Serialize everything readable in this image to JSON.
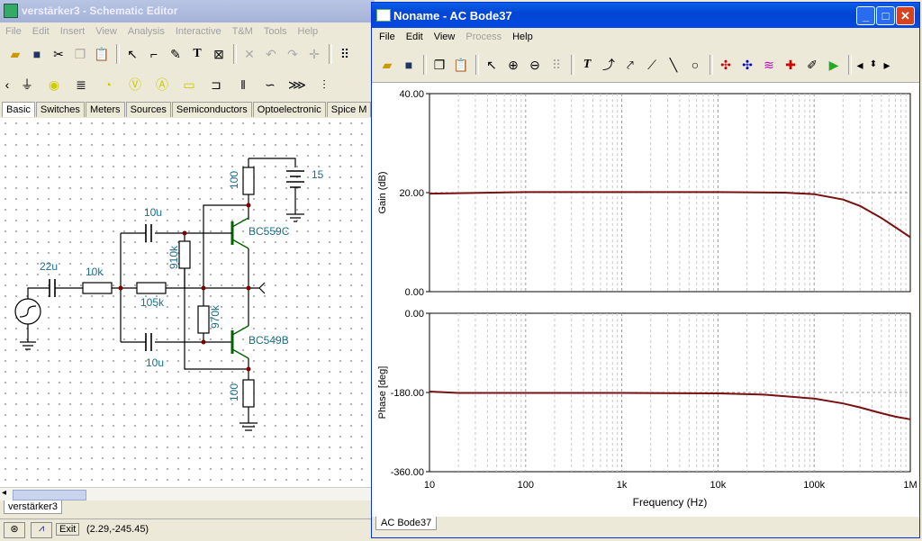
{
  "schematic": {
    "title": "verstärker3 - Schematic Editor",
    "menu": [
      "File",
      "Edit",
      "Insert",
      "View",
      "Analysis",
      "Interactive",
      "T&M",
      "Tools",
      "Help"
    ],
    "tabs": [
      "Basic",
      "Switches",
      "Meters",
      "Sources",
      "Semiconductors",
      "Optoelectronic",
      "Spice M"
    ],
    "sheet_tab": "verstärker3",
    "exit_label": "Exit",
    "coords": "(2.29,-245.45)",
    "labels": {
      "r_top": "100",
      "battery": "15",
      "c1": "10u",
      "q1": "BC559C",
      "r_910": "910k",
      "c_in": "22u",
      "r_10k": "10k",
      "r_105k": "105k",
      "r_970": "970k",
      "q2": "BC549B",
      "c2": "10u",
      "r_bot": "100"
    }
  },
  "bode": {
    "title": "Noname - AC Bode37",
    "menu": [
      "File",
      "Edit",
      "View",
      "Process",
      "Help"
    ],
    "bottom_tab": "AC Bode37",
    "gain_ylabel": "Gain (dB)",
    "phase_ylabel": "Phase [deg]",
    "xlabel": "Frequency (Hz)",
    "gain_ticks": [
      "40.00",
      "20.00",
      "0.00"
    ],
    "phase_ticks": [
      "0.00",
      "-180.00",
      "-360.00"
    ],
    "x_ticks": [
      "10",
      "100",
      "1k",
      "10k",
      "100k",
      "1M"
    ],
    "curve_color": "#7a1010"
  },
  "chart_data": [
    {
      "type": "line",
      "title": "",
      "xlabel": "Frequency (Hz)",
      "ylabel": "Gain (dB)",
      "xscale": "log",
      "xlim": [
        10,
        1000000
      ],
      "ylim": [
        0,
        40
      ],
      "grid": true,
      "series": [
        {
          "x": [
            10,
            100,
            1000,
            10000,
            50000,
            100000,
            200000,
            300000,
            500000,
            700000,
            1000000
          ],
          "y": [
            19.8,
            20.1,
            20.1,
            20.1,
            20.0,
            19.7,
            18.6,
            17.3,
            14.9,
            13.0,
            11.0
          ]
        }
      ]
    },
    {
      "type": "line",
      "title": "",
      "xlabel": "Frequency (Hz)",
      "ylabel": "Phase [deg]",
      "xscale": "log",
      "xlim": [
        10,
        1000000
      ],
      "ylim": [
        -360,
        0
      ],
      "grid": true,
      "series": [
        {
          "x": [
            10,
            20,
            100,
            1000,
            10000,
            30000,
            100000,
            200000,
            300000,
            500000,
            700000,
            1000000
          ],
          "y": [
            -178,
            -181,
            -181,
            -181,
            -182,
            -185,
            -194,
            -205,
            -214,
            -227,
            -235,
            -241
          ]
        }
      ]
    }
  ]
}
